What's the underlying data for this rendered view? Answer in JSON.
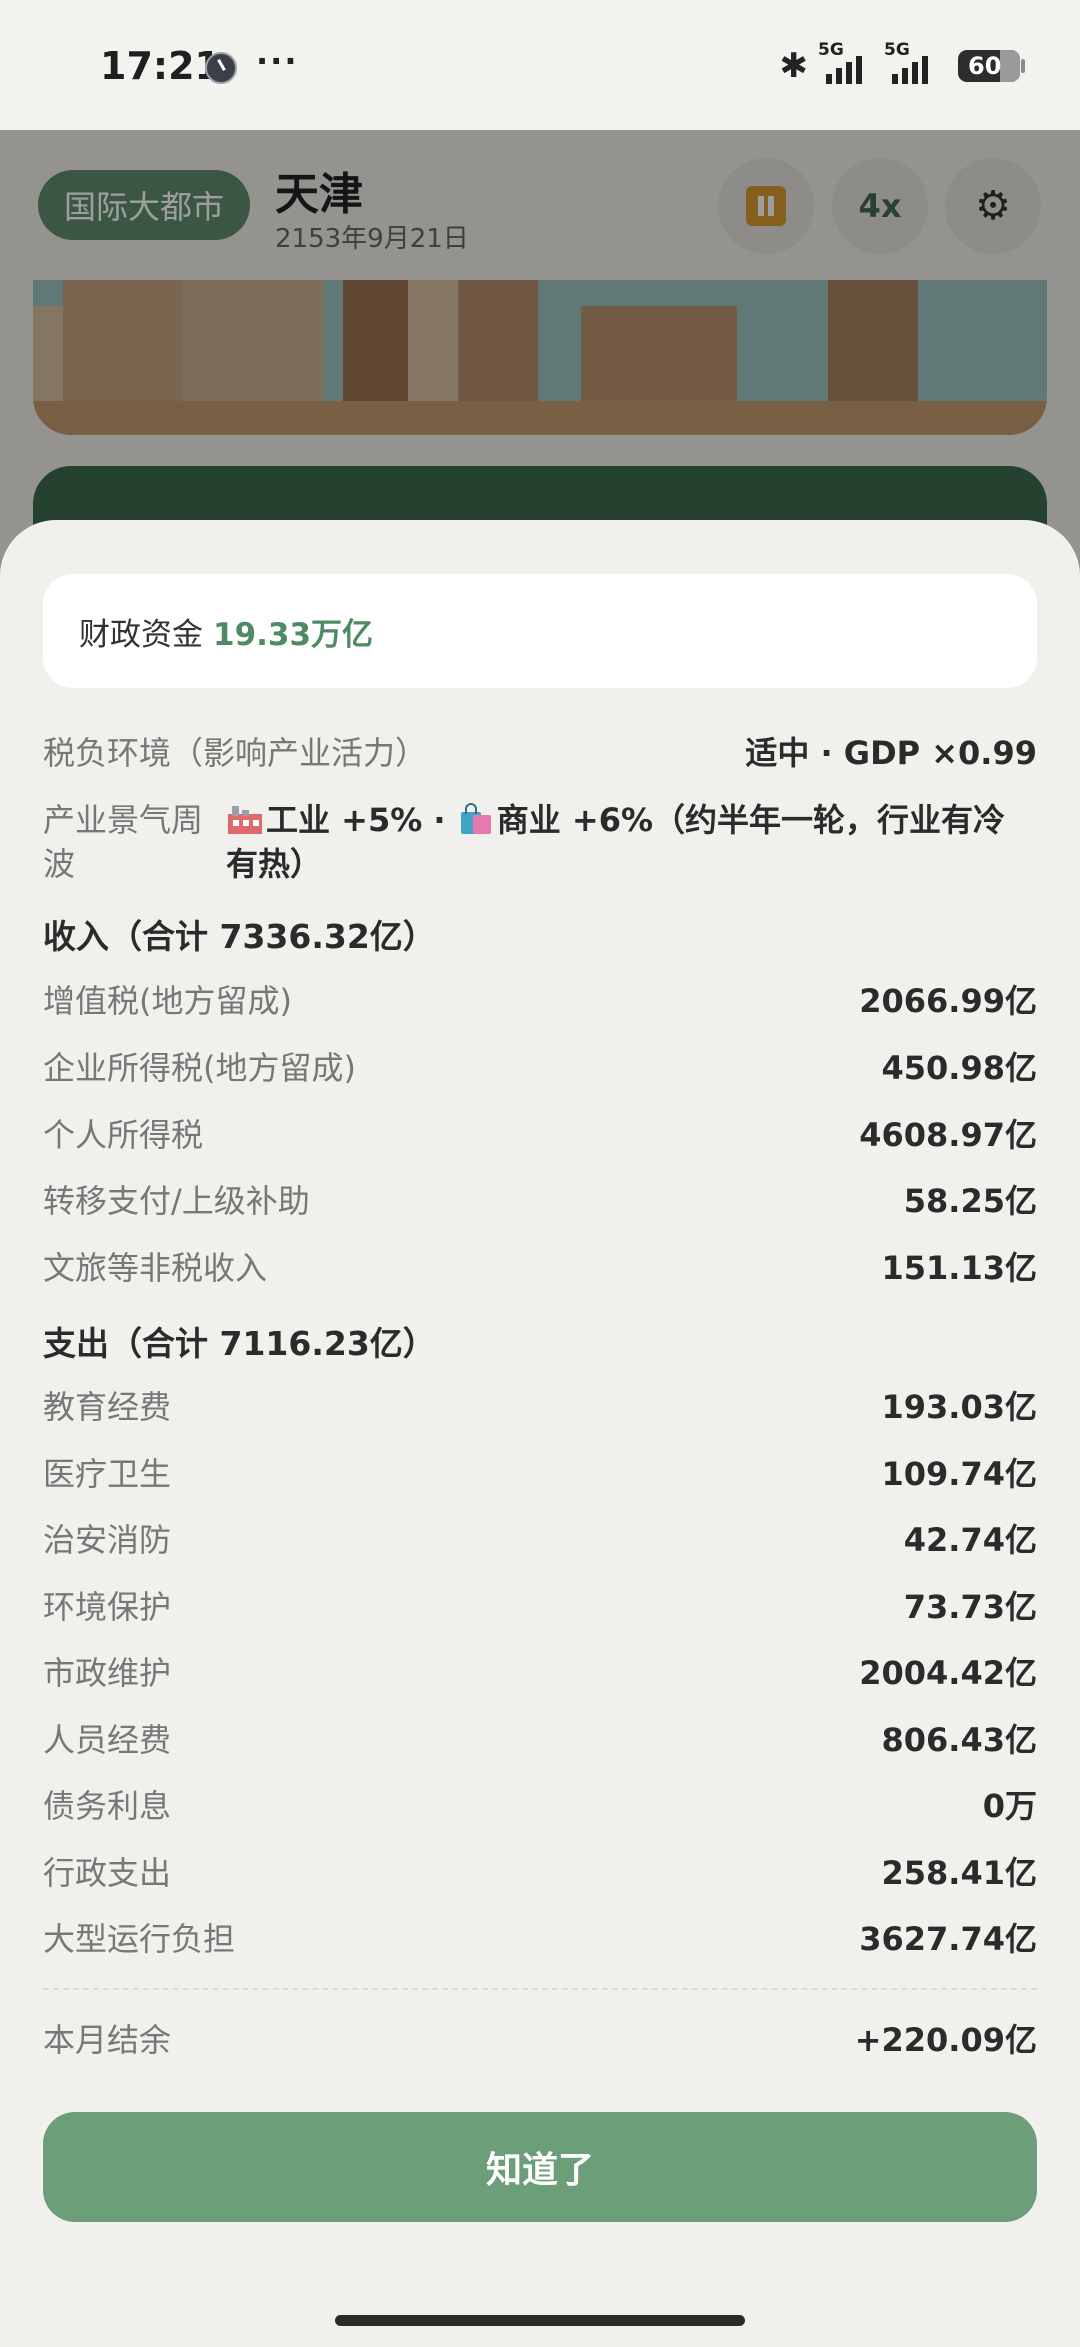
{
  "status_bar": {
    "time": "17:21",
    "more": "···",
    "network_1": "5G",
    "network_2": "5G",
    "battery": "60"
  },
  "header": {
    "tier_badge": "国际大都市",
    "city": "天津",
    "date": "2153年9月21日",
    "speed": "4x"
  },
  "sheet": {
    "funds_label": "财政资金",
    "funds_value": "19.33万亿",
    "tax_env": {
      "label": "税负环境（影响产业活力）",
      "value": "适中 · GDP ×0.99"
    },
    "cycle": {
      "label": "产业景气周波",
      "value_part1": "工业 +5% · ",
      "value_part2": "商业 +6%（约半年一轮，行业有冷有热）"
    },
    "income_title": "收入（合计 7336.32亿）",
    "income_rows": [
      {
        "label": "增值税(地方留成)",
        "value": "2066.99亿"
      },
      {
        "label": "企业所得税(地方留成)",
        "value": "450.98亿"
      },
      {
        "label": "个人所得税",
        "value": "4608.97亿"
      },
      {
        "label": "转移支付/上级补助",
        "value": "58.25亿"
      },
      {
        "label": "文旅等非税收入",
        "value": "151.13亿"
      }
    ],
    "expense_title": "支出（合计 7116.23亿）",
    "expense_rows": [
      {
        "label": "教育经费",
        "value": "193.03亿"
      },
      {
        "label": "医疗卫生",
        "value": "109.74亿"
      },
      {
        "label": "治安消防",
        "value": "42.74亿"
      },
      {
        "label": "环境保护",
        "value": "73.73亿"
      },
      {
        "label": "市政维护",
        "value": "2004.42亿"
      },
      {
        "label": "人员经费",
        "value": "806.43亿"
      },
      {
        "label": "债务利息",
        "value": "0万"
      },
      {
        "label": "行政支出",
        "value": "258.41亿"
      },
      {
        "label": "大型运行负担",
        "value": "3627.74亿"
      }
    ],
    "balance": {
      "label": "本月结余",
      "value": "+220.09亿"
    },
    "ok_button": "知道了"
  },
  "colors": {
    "accent": "#6c9e7a",
    "funds_value": "#4e8a64",
    "badge": "#5f8b6b"
  }
}
